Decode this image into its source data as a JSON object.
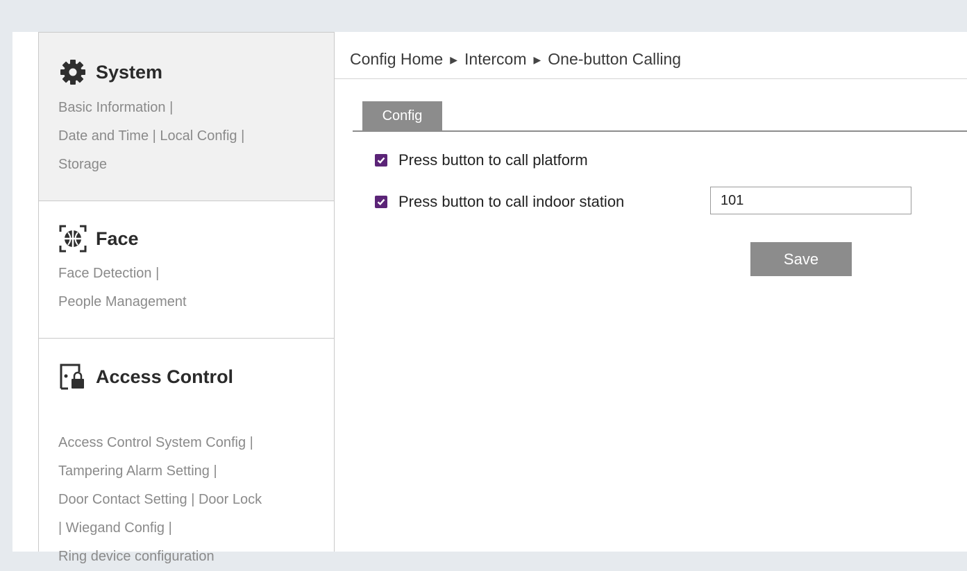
{
  "sidebar": {
    "system": {
      "title": "System",
      "icon": "gear-icon",
      "links": [
        "Basic Information |",
        "Date and Time | Local Config |",
        "Storage"
      ]
    },
    "face": {
      "title": "Face",
      "icon": "face-scan-icon",
      "links": [
        "Face Detection |",
        "People Management"
      ]
    },
    "access": {
      "title": "Access Control",
      "icon": "door-lock-icon",
      "links": [
        "Access Control System Config |",
        "Tampering Alarm Setting |",
        "Door Contact Setting | Door Lock",
        " | Wiegand Config |",
        "Ring device configuration"
      ]
    }
  },
  "breadcrumb": {
    "items": [
      "Config Home",
      "Intercom",
      "One-button Calling"
    ],
    "separator_icon": "triangle-right-icon"
  },
  "tabs": [
    {
      "label": "Config",
      "active": true
    }
  ],
  "form": {
    "call_platform": {
      "label": "Press button to call platform",
      "checked": true
    },
    "call_indoor": {
      "label": "Press button to call indoor station",
      "checked": true,
      "value": "101"
    },
    "save_label": "Save"
  },
  "colors": {
    "checkbox": "#5b2477",
    "button_gray": "#8c8c8c",
    "sidebar_active_bg": "#f1f1f1"
  }
}
